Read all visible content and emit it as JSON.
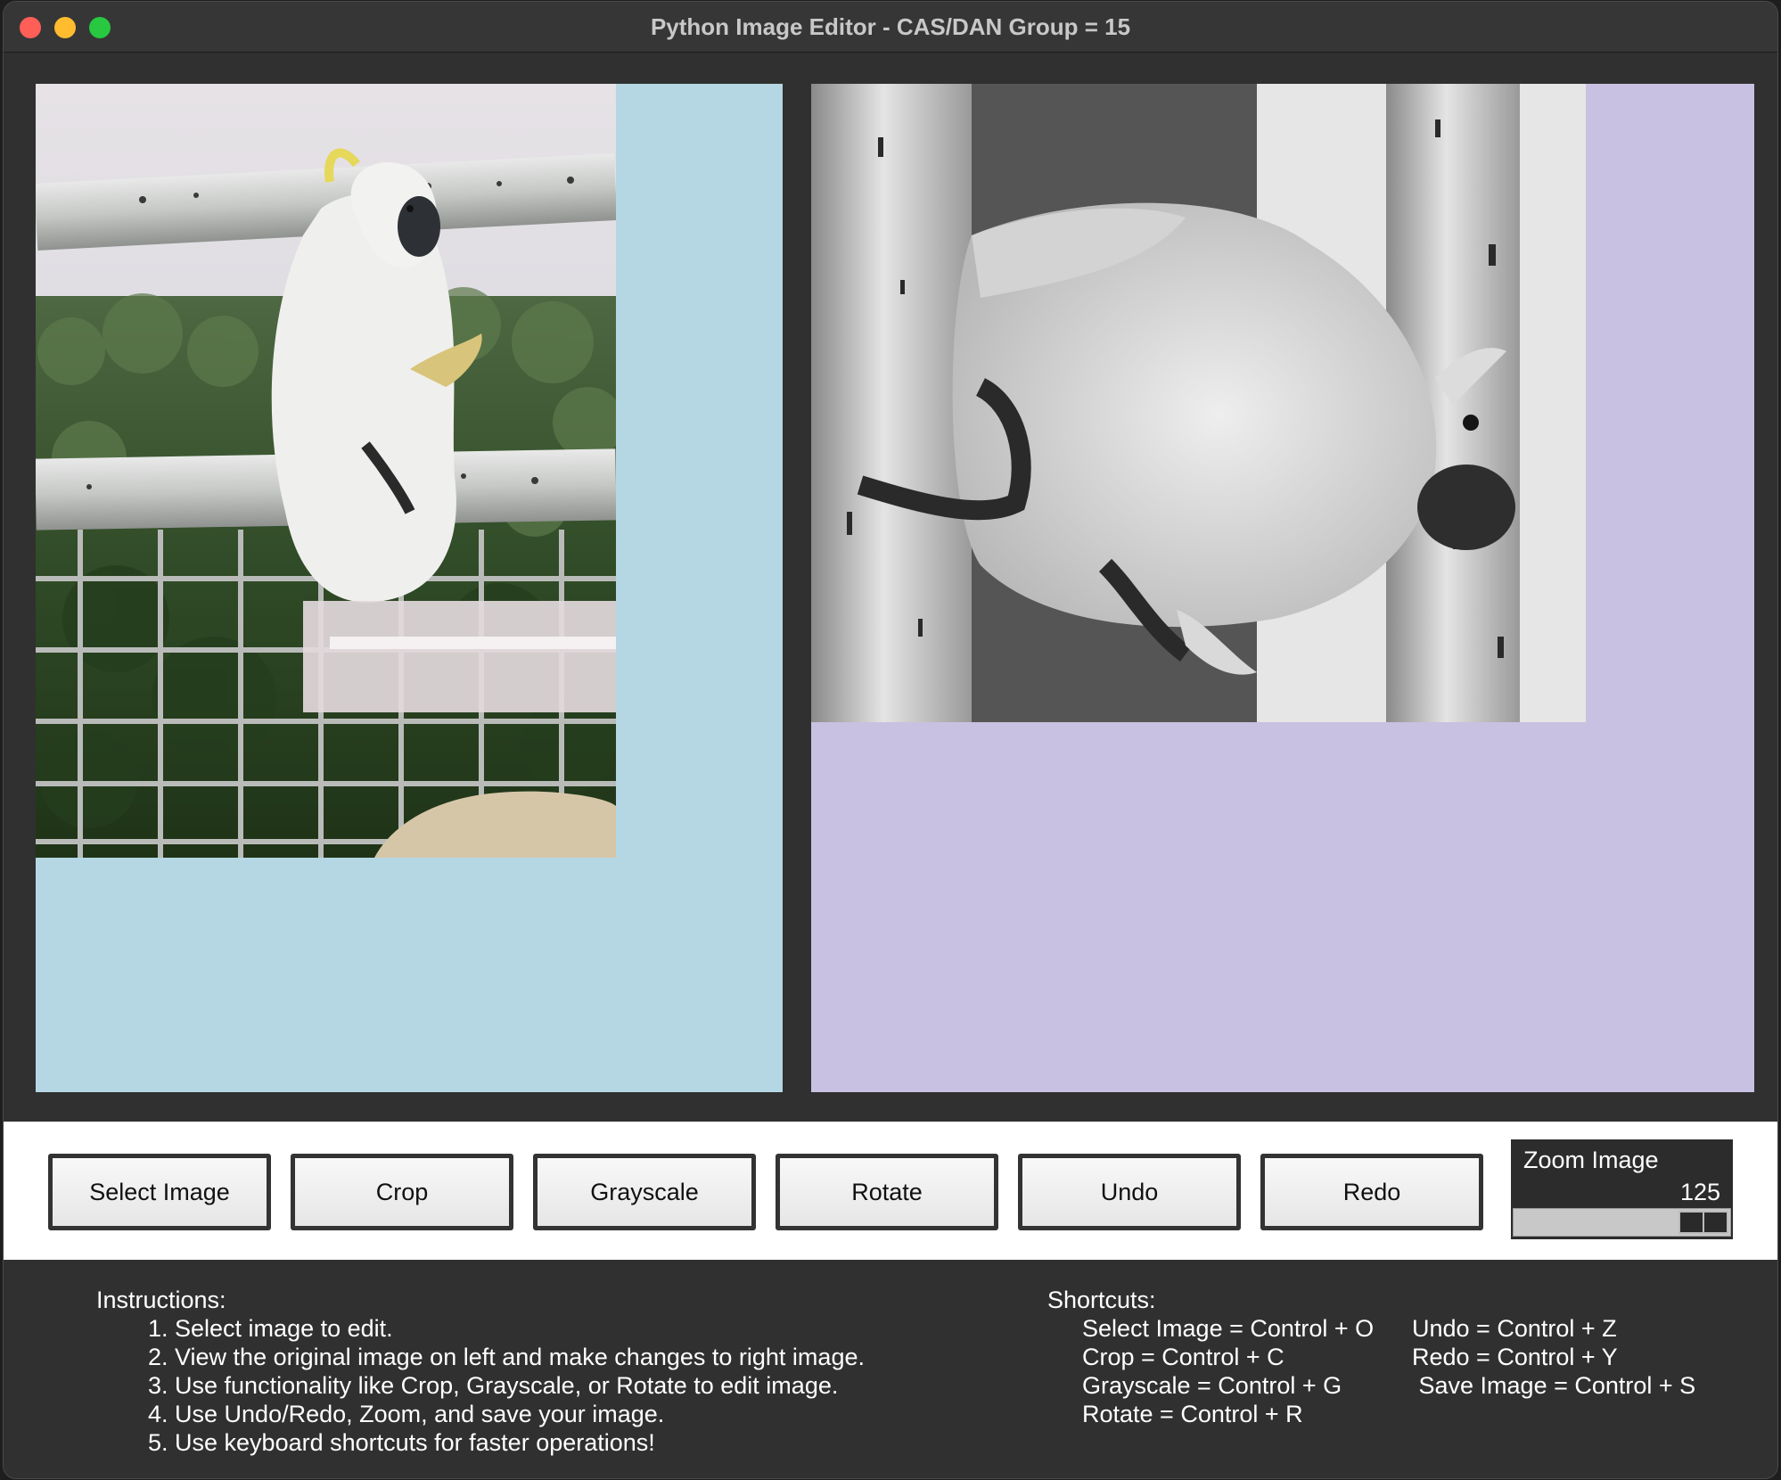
{
  "window": {
    "title": "Python Image Editor - CAS/DAN Group = 15"
  },
  "toolbar": {
    "buttons": [
      "Select Image",
      "Crop",
      "Grayscale",
      "Rotate",
      "Undo",
      "Redo"
    ]
  },
  "zoom": {
    "label": "Zoom Image",
    "value": 125,
    "level_fraction": 1.0
  },
  "instructions": {
    "heading": "Instructions:",
    "items": [
      "1. Select image to edit.",
      "2. View the original image on left and make changes to right image.",
      "3. Use functionality like Crop, Grayscale, or Rotate to edit image.",
      "4. Use Undo/Redo, Zoom, and save your image.",
      "5. Use keyboard shortcuts for faster operations!"
    ]
  },
  "shortcuts": {
    "heading": "Shortcuts:",
    "col1": [
      "Select Image = Control + O",
      "Crop = Control + C",
      "Grayscale = Control + G",
      "Rotate = Control + R"
    ],
    "col2": [
      "Undo = Control + Z",
      "Redo = Control + Y",
      " Save Image = Control + S"
    ]
  },
  "colors": {
    "left_canvas": "#b5d7e3",
    "right_canvas": "#c9c1e1"
  }
}
